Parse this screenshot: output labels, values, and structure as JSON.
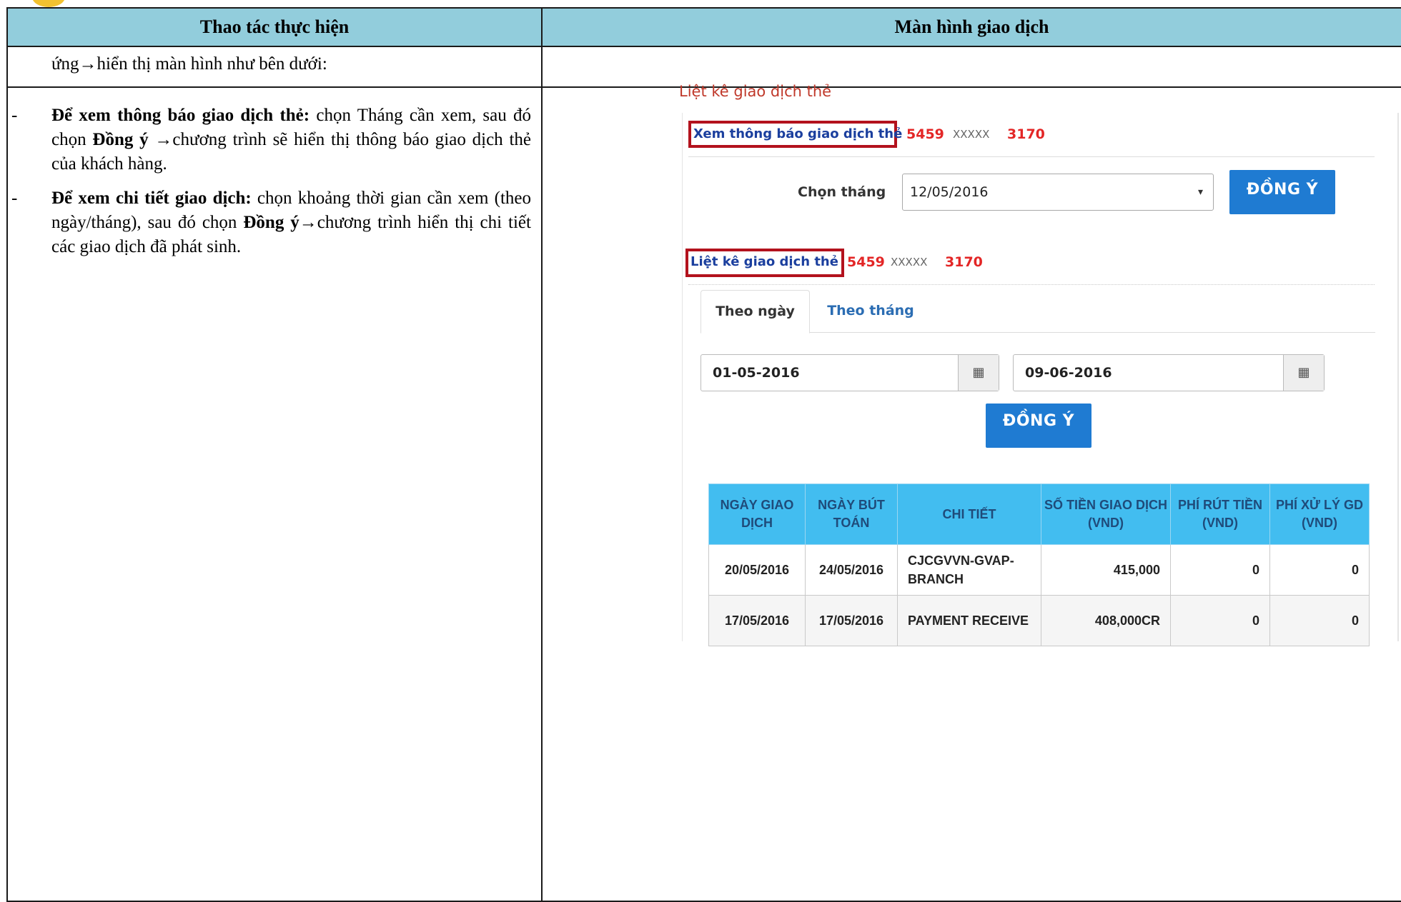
{
  "doc": {
    "col_left_header": "Thao tác thực hiện",
    "col_right_header": "Màn hình giao dịch",
    "continuation": "ứng→hiển thị màn hình như bên dưới:",
    "bullets": [
      {
        "dash": "-",
        "bold": "Để xem thông báo giao dịch thẻ:",
        "t1": " chọn Tháng cần xem, sau đó chọn ",
        "bold2": "Đồng ý",
        "t2": " →chương trình sẽ hiển thị thông báo giao dịch thẻ của khách hàng."
      },
      {
        "dash": "-",
        "bold": "Để xem chi tiết giao dịch:",
        "t1": " chọn khoảng thời gian cần xem (theo ngày/tháng), sau đó chọn ",
        "bold2": "Đồng ý",
        "t2": "→chương trình hiển thị chi tiết các giao dịch đã phát sinh."
      }
    ]
  },
  "screen": {
    "section_title": "Liệt kê giao dịch thẻ",
    "notice": {
      "header": "Xem thông báo giao dịch thẻ",
      "card_first": "5459",
      "card_mask": "XXXXX",
      "card_last": "3170",
      "month_label": "Chọn tháng",
      "month_value": "12/05/2016",
      "caret": "▾",
      "ok_button": "ĐỒNG Ý"
    },
    "list": {
      "header": "Liệt kê giao dịch thẻ",
      "card_first": "5459",
      "card_mask": "XXXXX",
      "card_last": "3170",
      "tab_day": "Theo ngày",
      "tab_month": "Theo tháng",
      "from_date": "01-05-2016",
      "to_date": "09-06-2016",
      "calendar_glyph": "▦",
      "ok_button": "ĐỒNG Ý"
    },
    "table": {
      "headers": [
        "NGÀY GIAO DỊCH",
        "NGÀY BÚT TOÁN",
        "CHI TIẾT",
        "SỐ TIỀN GIAO DỊCH (VND)",
        "PHÍ RÚT TIỀN (VND)",
        "PHÍ XỬ LÝ GD (VND)"
      ],
      "rows": [
        [
          "20/05/2016",
          "24/05/2016",
          "CJCGVVN-GVAP-BRANCH",
          "415,000",
          "0",
          "0"
        ],
        [
          "17/05/2016",
          "17/05/2016",
          "PAYMENT RECEIVE",
          "408,000CR",
          "0",
          "0"
        ]
      ]
    }
  }
}
